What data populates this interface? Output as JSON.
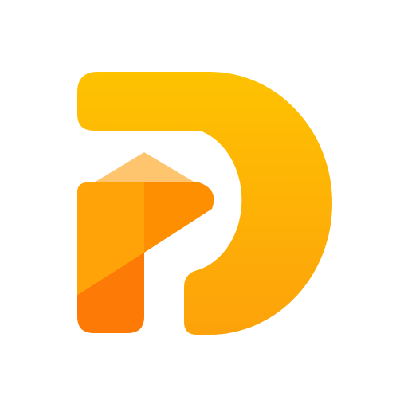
{
  "logo": {
    "icon_name": "stylized-letter-d-with-pencil-logo",
    "colors": {
      "background": "#ffffff",
      "d_gradient_top": "#FEC201",
      "d_gradient_bottom": "#FDA20A",
      "pencil_tip": "#FFC46E",
      "pencil_body_light": "#FFA309",
      "pencil_body_mid": "#FD8F01",
      "pencil_body_dark": "#FC7A05"
    }
  }
}
